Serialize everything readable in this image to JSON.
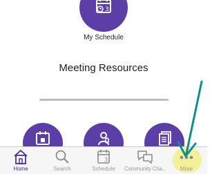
{
  "top_tile": {
    "label": "My Schedule",
    "icon": "calendar-clock-icon"
  },
  "section": {
    "title": "Meeting Resources"
  },
  "resources": [
    {
      "icon": "calendar-pin-icon"
    },
    {
      "icon": "speaker-icon"
    },
    {
      "icon": "documents-icon"
    }
  ],
  "tabbar": {
    "items": [
      {
        "label": "Home",
        "icon": "home-icon",
        "active": true
      },
      {
        "label": "Search",
        "icon": "magnifier-icon"
      },
      {
        "label": "Schedule",
        "icon": "calendar-icon"
      },
      {
        "label": "Community Cha...",
        "icon": "chat-bubbles-icon"
      },
      {
        "label": "More",
        "icon": "more-dots-icon"
      }
    ]
  },
  "colors": {
    "brand_purple": "#5b3fa6",
    "active_tab": "#4a2f9a",
    "inactive_tab": "#9a9a9a",
    "arrow_teal": "#0f8f88",
    "highlight_yellow": "#f4f08e"
  }
}
